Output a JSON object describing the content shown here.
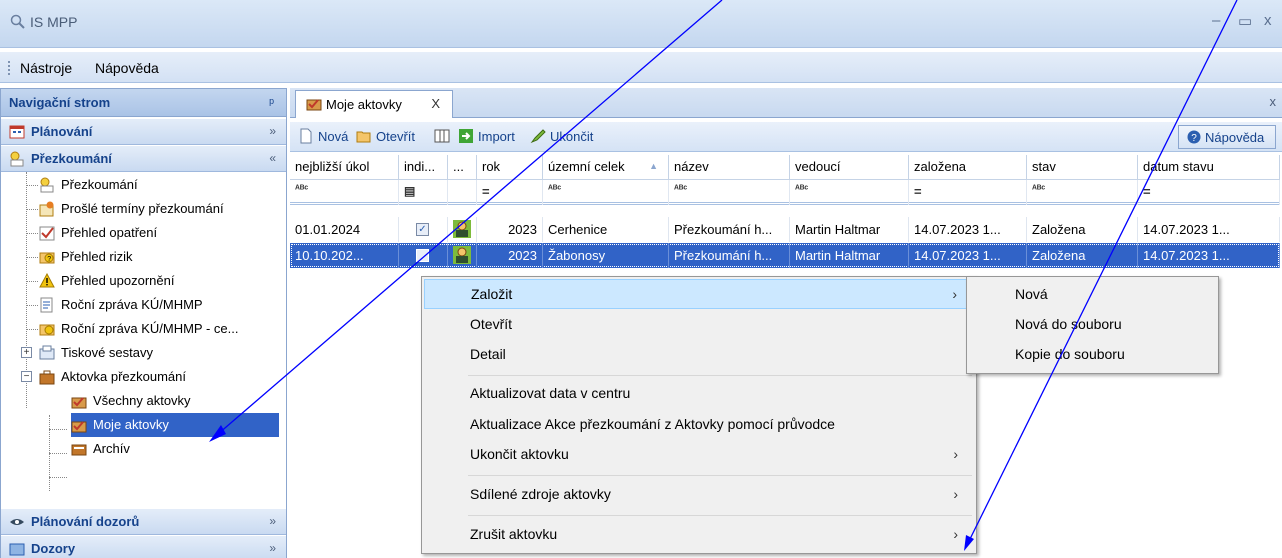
{
  "window": {
    "title": "IS MPP",
    "min": "–",
    "max": "▭",
    "close": "x"
  },
  "menu": {
    "items": [
      "Nástroje",
      "Nápověda"
    ]
  },
  "nav": {
    "title": "Navigační strom",
    "pin": "ᵖ",
    "groups": {
      "planovani": "Plánování",
      "prezkoumani": "Přezkoumání",
      "dozory_plan": "Plánování dozorů",
      "dozory": "Dozory"
    },
    "items": [
      "Přezkoumání",
      "Prošlé termíny přezkoumání",
      "Přehled opatření",
      "Přehled rizik",
      "Přehled upozornění",
      "Roční zpráva KÚ/MHMP",
      "Roční zpráva KÚ/MHMP - ce...",
      "Tiskové sestavy",
      "Aktovka přezkoumání",
      "Všechny aktovky",
      "Moje aktovky",
      "Archív"
    ]
  },
  "tab": {
    "label": "Moje aktovky",
    "close": "X",
    "strip_close": "x"
  },
  "toolbar": {
    "new": "Nová",
    "open": "Otevřít",
    "import": "Import",
    "finish": "Ukončit",
    "help": "Nápověda"
  },
  "grid": {
    "columns": [
      "nejbližší úkol",
      "indi...",
      "...",
      "rok",
      "územní celek",
      "název",
      "vedoucí",
      "založena",
      "stav",
      "datum stavu"
    ],
    "filters": [
      "ᴬᴮᶜ",
      "▤",
      "",
      "=",
      "ᴬᴮᶜ",
      "ᴬᴮᶜ",
      "ᴬᴮᶜ",
      "=",
      "ᴬᴮᶜ",
      "="
    ],
    "rows": [
      [
        "01.01.2024",
        "",
        "",
        "2023",
        "Cerhenice",
        "Přezkoumání h...",
        "Martin Haltmar",
        "14.07.2023 1...",
        "Založena",
        "14.07.2023 1..."
      ],
      [
        "10.10.202...",
        "",
        "",
        "2023",
        "Žabonosy",
        "Přezkoumání h...",
        "Martin Haltmar",
        "14.07.2023 1...",
        "Založena",
        "14.07.2023 1..."
      ]
    ]
  },
  "context_menu": {
    "items": [
      "Založit",
      "Otevřít",
      "Detail",
      "Aktualizovat data v centru",
      "Aktualizace Akce přezkoumání z Aktovky pomocí průvodce",
      "Ukončit aktovku",
      "Sdílené zdroje aktovky",
      "Zrušit aktovku"
    ],
    "arrow": "›"
  },
  "submenu": {
    "items": [
      "Nová",
      "Nová do souboru",
      "Kopie do souboru"
    ]
  },
  "colors": {
    "accent": "#3163c7",
    "arrow": "#0000ff"
  }
}
